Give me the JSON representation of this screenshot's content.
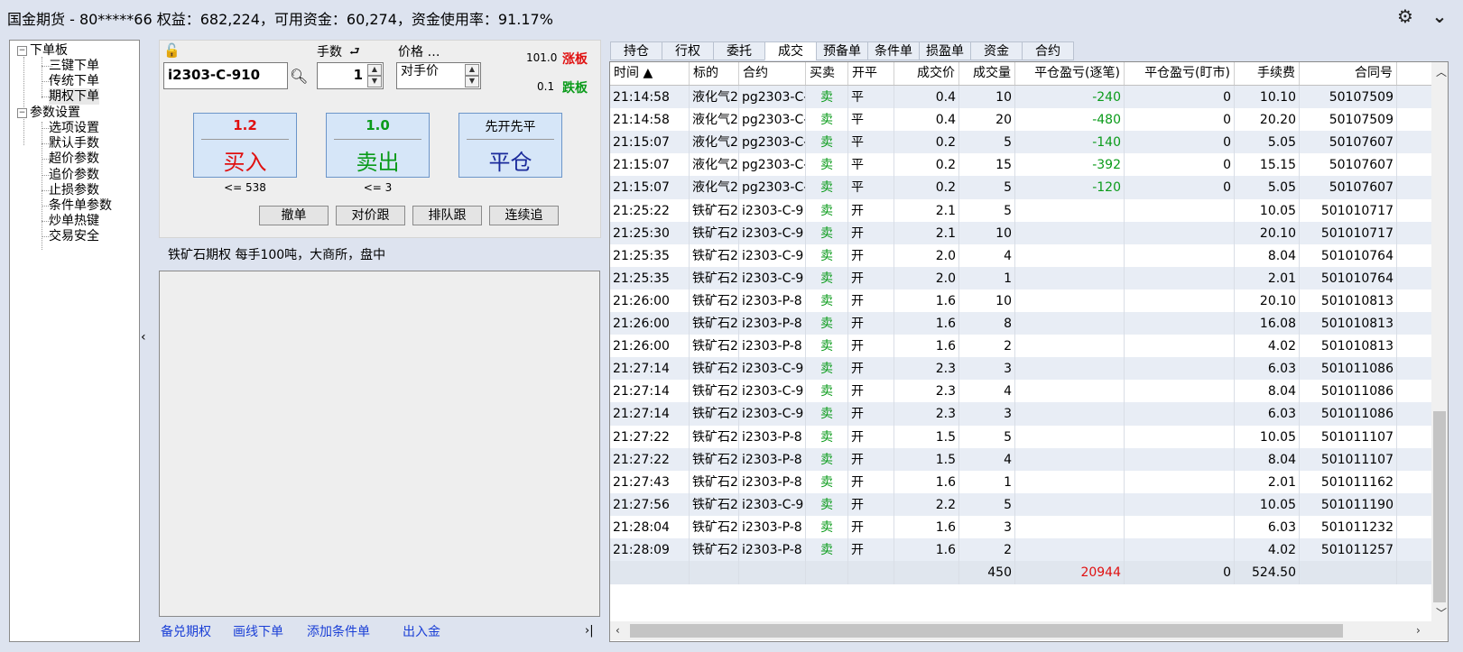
{
  "header": {
    "title": "国金期货 - 80*****66  权益：682,224，可用资金：60,274，资金使用率：91.17%",
    "settings_icon": "⚙",
    "menu_icon": "⌄"
  },
  "tree": {
    "group1": "下单板",
    "items1": [
      "三键下单",
      "传统下单",
      "期权下单"
    ],
    "group2": "参数设置",
    "items2": [
      "选项设置",
      "默认手数",
      "超价参数",
      "追价参数",
      "止损参数",
      "条件单参数",
      "炒单热键",
      "交易安全"
    ]
  },
  "order": {
    "contract": "i2303-C-910",
    "qty_label": "手数",
    "qty": "1",
    "price_label": "价格 …",
    "price_value": "对手价",
    "limit_up": "101.0",
    "limit_up_label": "涨板",
    "limit_down": "0.1",
    "limit_down_label": "跌板",
    "buy_price": "1.2",
    "buy_label": "买入",
    "buy_sub": "<= 538",
    "sell_price": "1.0",
    "sell_label": "卖出",
    "sell_sub": "<= 3",
    "close_top": "先开先平",
    "close_label": "平仓",
    "btn_cancel": "撤单",
    "btn_counter": "对价跟",
    "btn_queue": "排队跟",
    "btn_chase": "连续追",
    "info": "铁矿石期权  每手100吨，大商所，盘中"
  },
  "links": [
    "备兑期权",
    "画线下单",
    "添加条件单",
    "出入金"
  ],
  "tabs": [
    "持仓",
    "行权",
    "委托",
    "成交",
    "预备单",
    "条件单",
    "损盈单",
    "资金",
    "合约"
  ],
  "active_tab": "成交",
  "columns": [
    "时间 ▲",
    "标的",
    "合约",
    "买卖",
    "开平",
    "成交价",
    "成交量",
    "平仓盈亏(逐笔)",
    "平仓盈亏(盯市)",
    "手续费",
    "合同号"
  ],
  "rows": [
    [
      "21:14:58",
      "液化气2",
      "pg2303-C-",
      "卖",
      "平",
      "0.4",
      "10",
      "-240",
      "0",
      "10.10",
      "50107509"
    ],
    [
      "21:14:58",
      "液化气2",
      "pg2303-C-",
      "卖",
      "平",
      "0.4",
      "20",
      "-480",
      "0",
      "20.20",
      "50107509"
    ],
    [
      "21:15:07",
      "液化气2",
      "pg2303-C-",
      "卖",
      "平",
      "0.2",
      "5",
      "-140",
      "0",
      "5.05",
      "50107607"
    ],
    [
      "21:15:07",
      "液化气2",
      "pg2303-C-",
      "卖",
      "平",
      "0.2",
      "15",
      "-392",
      "0",
      "15.15",
      "50107607"
    ],
    [
      "21:15:07",
      "液化气2",
      "pg2303-C-",
      "卖",
      "平",
      "0.2",
      "5",
      "-120",
      "0",
      "5.05",
      "50107607"
    ],
    [
      "21:25:22",
      "铁矿石2",
      "i2303-C-9",
      "卖",
      "开",
      "2.1",
      "5",
      "",
      "",
      "10.05",
      "501010717"
    ],
    [
      "21:25:30",
      "铁矿石2",
      "i2303-C-9",
      "卖",
      "开",
      "2.1",
      "10",
      "",
      "",
      "20.10",
      "501010717"
    ],
    [
      "21:25:35",
      "铁矿石2",
      "i2303-C-9",
      "卖",
      "开",
      "2.0",
      "4",
      "",
      "",
      "8.04",
      "501010764"
    ],
    [
      "21:25:35",
      "铁矿石2",
      "i2303-C-9",
      "卖",
      "开",
      "2.0",
      "1",
      "",
      "",
      "2.01",
      "501010764"
    ],
    [
      "21:26:00",
      "铁矿石2",
      "i2303-P-8",
      "卖",
      "开",
      "1.6",
      "10",
      "",
      "",
      "20.10",
      "501010813"
    ],
    [
      "21:26:00",
      "铁矿石2",
      "i2303-P-8",
      "卖",
      "开",
      "1.6",
      "8",
      "",
      "",
      "16.08",
      "501010813"
    ],
    [
      "21:26:00",
      "铁矿石2",
      "i2303-P-8",
      "卖",
      "开",
      "1.6",
      "2",
      "",
      "",
      "4.02",
      "501010813"
    ],
    [
      "21:27:14",
      "铁矿石2",
      "i2303-C-9",
      "卖",
      "开",
      "2.3",
      "3",
      "",
      "",
      "6.03",
      "501011086"
    ],
    [
      "21:27:14",
      "铁矿石2",
      "i2303-C-9",
      "卖",
      "开",
      "2.3",
      "4",
      "",
      "",
      "8.04",
      "501011086"
    ],
    [
      "21:27:14",
      "铁矿石2",
      "i2303-C-9",
      "卖",
      "开",
      "2.3",
      "3",
      "",
      "",
      "6.03",
      "501011086"
    ],
    [
      "21:27:22",
      "铁矿石2",
      "i2303-P-8",
      "卖",
      "开",
      "1.5",
      "5",
      "",
      "",
      "10.05",
      "501011107"
    ],
    [
      "21:27:22",
      "铁矿石2",
      "i2303-P-8",
      "卖",
      "开",
      "1.5",
      "4",
      "",
      "",
      "8.04",
      "501011107"
    ],
    [
      "21:27:43",
      "铁矿石2",
      "i2303-P-8",
      "卖",
      "开",
      "1.6",
      "1",
      "",
      "",
      "2.01",
      "501011162"
    ],
    [
      "21:27:56",
      "铁矿石2",
      "i2303-C-9",
      "卖",
      "开",
      "2.2",
      "5",
      "",
      "",
      "10.05",
      "501011190"
    ],
    [
      "21:28:04",
      "铁矿石2",
      "i2303-P-8",
      "卖",
      "开",
      "1.6",
      "3",
      "",
      "",
      "6.03",
      "501011232"
    ],
    [
      "21:28:09",
      "铁矿石2",
      "i2303-P-8",
      "卖",
      "开",
      "1.6",
      "2",
      "",
      "",
      "4.02",
      "501011257"
    ]
  ],
  "totals": {
    "volume": "450",
    "pnl_trade": "20944",
    "pnl_mark": "0",
    "fee": "524.50"
  },
  "colors": {
    "buy": "#e01010",
    "sell": "#0a9b1a",
    "close": "#1a2a9b",
    "link": "#1a3fd6"
  }
}
